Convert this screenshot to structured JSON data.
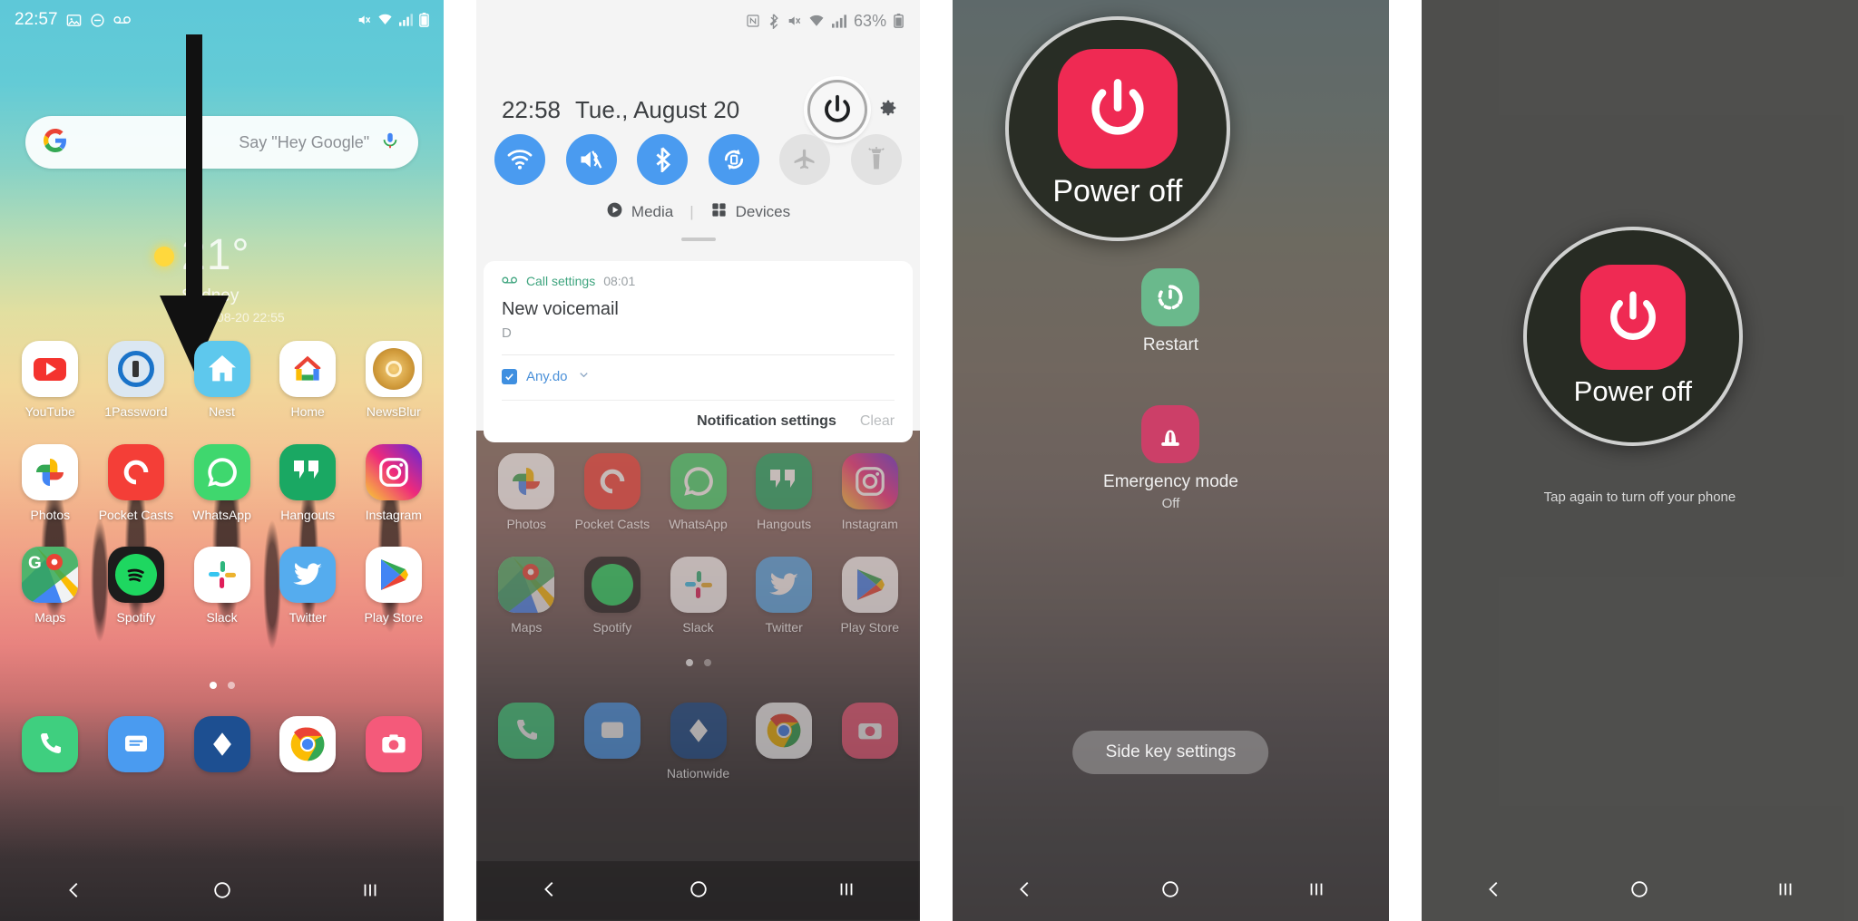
{
  "panel1": {
    "name": "home-screen",
    "statusbar": {
      "time": "22:57",
      "left_icons": [
        "photo-icon",
        "do-not-disturb-icon",
        "voicemail-icon"
      ],
      "right_icons": [
        "mute-icon",
        "wifi-icon",
        "signal-icon",
        "battery-icon"
      ]
    },
    "search": {
      "logo": "google-g-icon",
      "placeholder": "Say \"Hey Google\"",
      "mic": "microphone-icon"
    },
    "weather": {
      "temperature": "21°",
      "city": "Sydney",
      "updated": "dated 08-20 22:55",
      "icon": "sun-icon",
      "refresh": "refresh-icon"
    },
    "arrow": {
      "name": "swipe-down-arrow"
    },
    "apps_row1": [
      {
        "label": "YouTube",
        "icon": "youtube-icon"
      },
      {
        "label": "1Password",
        "icon": "1password-icon"
      },
      {
        "label": "Nest",
        "icon": "nest-icon"
      },
      {
        "label": "Home",
        "icon": "google-home-icon"
      },
      {
        "label": "NewsBlur",
        "icon": "newsblur-icon"
      }
    ],
    "apps_row2": [
      {
        "label": "Photos",
        "icon": "google-photos-icon"
      },
      {
        "label": "Pocket Casts",
        "icon": "pocket-casts-icon"
      },
      {
        "label": "WhatsApp",
        "icon": "whatsapp-icon"
      },
      {
        "label": "Hangouts",
        "icon": "hangouts-icon"
      },
      {
        "label": "Instagram",
        "icon": "instagram-icon"
      }
    ],
    "apps_row3": [
      {
        "label": "Maps",
        "icon": "google-maps-icon"
      },
      {
        "label": "Spotify",
        "icon": "spotify-icon"
      },
      {
        "label": "Slack",
        "icon": "slack-icon"
      },
      {
        "label": "Twitter",
        "icon": "twitter-icon"
      },
      {
        "label": "Play Store",
        "icon": "play-store-icon"
      }
    ],
    "dock": [
      {
        "label": "",
        "icon": "phone-icon"
      },
      {
        "label": "",
        "icon": "messages-icon"
      },
      {
        "label": "",
        "icon": "nationwide-icon"
      },
      {
        "label": "",
        "icon": "chrome-icon"
      },
      {
        "label": "",
        "icon": "camera-icon"
      }
    ],
    "page_dots": 2,
    "active_dot": 0,
    "navbar": {
      "back": "back-icon",
      "home": "home-icon",
      "recents": "recents-icon"
    }
  },
  "panel2": {
    "name": "quick-settings-panel",
    "statusbar": {
      "icons": [
        "nfc-icon",
        "bluetooth-icon",
        "mute-icon",
        "wifi-icon",
        "signal-icon"
      ],
      "battery_percent": "63%",
      "battery_icon": "battery-icon"
    },
    "time": "22:58",
    "date": "Tue., August 20",
    "power_button": "power-icon",
    "settings_gear": "gear-icon",
    "toggles": [
      {
        "name": "wifi-toggle",
        "icon": "wifi-icon",
        "state": "on"
      },
      {
        "name": "sound-mode-toggle",
        "icon": "mute-vibrate-icon",
        "state": "on"
      },
      {
        "name": "bluetooth-toggle",
        "icon": "bluetooth-icon",
        "state": "on"
      },
      {
        "name": "auto-rotate-toggle",
        "icon": "rotate-icon",
        "state": "on"
      },
      {
        "name": "airplane-mode-toggle",
        "icon": "airplane-icon",
        "state": "off"
      },
      {
        "name": "flashlight-toggle",
        "icon": "flashlight-icon",
        "state": "off"
      }
    ],
    "media_label": "Media",
    "media_icon": "play-circle-icon",
    "devices_label": "Devices",
    "devices_icon": "grid-icon",
    "notification": {
      "app": "Call settings",
      "app_icon": "voicemail-icon",
      "time": "08:01",
      "title": "New voicemail",
      "subtitle": "D",
      "group_app": "Any.do",
      "group_icon": "checkbox-icon",
      "expand_icon": "chevron-down-icon"
    },
    "footer": {
      "settings": "Notification settings",
      "clear": "Clear"
    },
    "dock_label": "Nationwide",
    "navbar": {
      "back": "back-icon",
      "home": "home-icon",
      "recents": "recents-icon"
    }
  },
  "panel3": {
    "name": "power-menu",
    "power_off_label": "Power off",
    "power_off_icon": "power-icon",
    "items": [
      {
        "label": "Restart",
        "icon": "restart-icon",
        "state": ""
      },
      {
        "label": "Emergency mode",
        "icon": "emergency-icon",
        "state": "Off"
      }
    ],
    "side_key_button": "Side key settings",
    "navbar": {
      "back": "back-icon",
      "home": "home-icon",
      "recents": "recents-icon"
    }
  },
  "panel4": {
    "name": "power-off-confirm",
    "power_off_label": "Power off",
    "power_off_icon": "power-icon",
    "hint": "Tap again to turn off your phone",
    "navbar": {
      "back": "back-icon",
      "home": "home-icon",
      "recents": "recents-icon"
    }
  },
  "colors": {
    "accent_blue": "#4a9bf0",
    "power_red": "#ef2a53",
    "restart_green": "#6ab98c",
    "emergency_pink": "#cc3f68",
    "notif_green": "#3ea47e"
  }
}
